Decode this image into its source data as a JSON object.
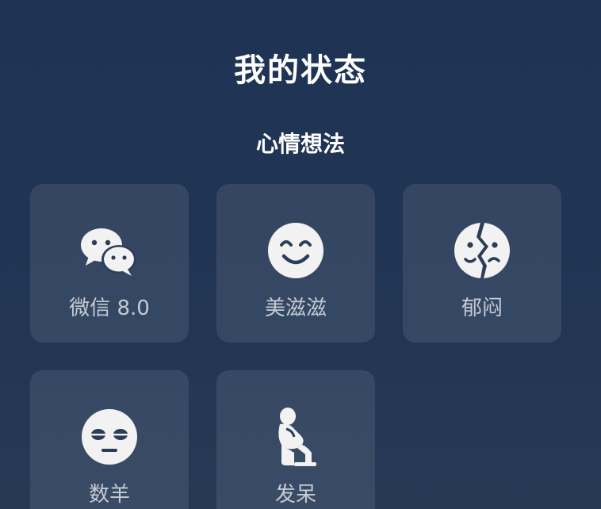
{
  "header": {
    "title": "我的状态"
  },
  "section": {
    "title": "心情想法"
  },
  "tiles": [
    {
      "label": "微信 8.0",
      "icon": "wechat-icon"
    },
    {
      "label": "美滋滋",
      "icon": "smile-icon"
    },
    {
      "label": "郁闷",
      "icon": "broken-face-icon"
    },
    {
      "label": "数羊",
      "icon": "sleepy-face-icon"
    },
    {
      "label": "发呆",
      "icon": "thinker-icon"
    }
  ],
  "colors": {
    "background_top": "#1f3355",
    "background_bottom": "#263a56",
    "tile_label": "#c5cad3",
    "icon": "#f2f2f2"
  }
}
